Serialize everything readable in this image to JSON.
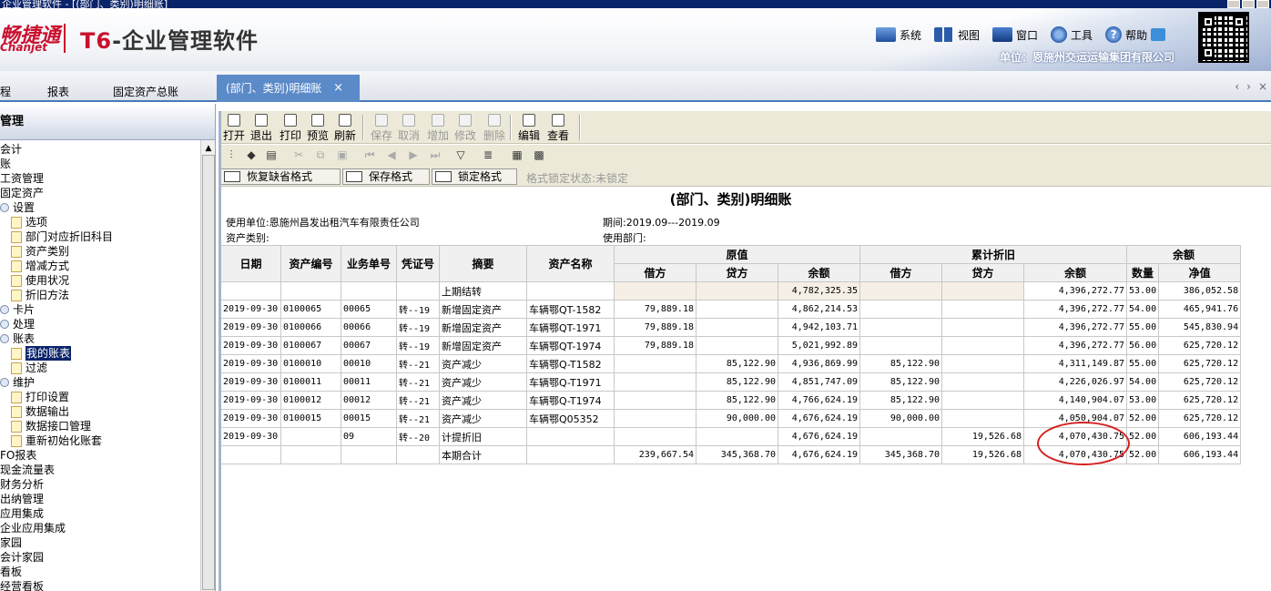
{
  "window": {
    "title": "企业管理软件 - [(部门、类别)明细账]"
  },
  "banner": {
    "logo_cn": "畅捷通",
    "logo_en": "Chanjet",
    "product_t6": "T6",
    "product_rest": "-企业管理软件",
    "menu": [
      {
        "label": "系统",
        "icon": "system-icon"
      },
      {
        "label": "视图",
        "icon": "view-icon"
      },
      {
        "label": "窗口",
        "icon": "window-icon"
      },
      {
        "label": "工具",
        "icon": "tools-icon"
      },
      {
        "label": "帮助",
        "icon": "help-icon"
      }
    ],
    "company": "单位：恩施州交运运输集团有限公司"
  },
  "tabs": {
    "items": [
      {
        "label": "程"
      },
      {
        "label": "报表"
      },
      {
        "label": "固定资产总账"
      }
    ],
    "active": "(部门、类别)明细账",
    "close": "×",
    "arrows": [
      "‹",
      "›",
      "×"
    ]
  },
  "left": {
    "header": "管理",
    "tree": [
      {
        "label": "会计",
        "level": 0,
        "type": "text"
      },
      {
        "label": "账",
        "level": 0,
        "type": "text"
      },
      {
        "label": "工资管理",
        "level": 0,
        "type": "text"
      },
      {
        "label": "固定资产",
        "level": 0,
        "type": "text"
      },
      {
        "label": "设置",
        "level": 1,
        "type": "expander"
      },
      {
        "label": "选项",
        "level": 2,
        "type": "folder"
      },
      {
        "label": "部门对应折旧科目",
        "level": 2,
        "type": "folder"
      },
      {
        "label": "资产类别",
        "level": 2,
        "type": "folder"
      },
      {
        "label": "增减方式",
        "level": 2,
        "type": "folder"
      },
      {
        "label": "使用状况",
        "level": 2,
        "type": "folder"
      },
      {
        "label": "折旧方法",
        "level": 2,
        "type": "folder"
      },
      {
        "label": "卡片",
        "level": 1,
        "type": "expander"
      },
      {
        "label": "处理",
        "level": 1,
        "type": "expander"
      },
      {
        "label": "账表",
        "level": 1,
        "type": "expander"
      },
      {
        "label": "我的账表",
        "level": 2,
        "type": "folder",
        "selected": true
      },
      {
        "label": "过滤",
        "level": 2,
        "type": "folder"
      },
      {
        "label": "维护",
        "level": 1,
        "type": "expander"
      },
      {
        "label": "打印设置",
        "level": 2,
        "type": "folder"
      },
      {
        "label": "数据输出",
        "level": 2,
        "type": "folder"
      },
      {
        "label": "数据接口管理",
        "level": 2,
        "type": "folder"
      },
      {
        "label": "重新初始化账套",
        "level": 2,
        "type": "folder"
      },
      {
        "label": "FO报表",
        "level": 0,
        "type": "text"
      },
      {
        "label": "现金流量表",
        "level": 0,
        "type": "text"
      },
      {
        "label": "财务分析",
        "level": 0,
        "type": "text"
      },
      {
        "label": "出纳管理",
        "level": 0,
        "type": "text"
      },
      {
        "label": "应用集成",
        "level": 0,
        "type": "text"
      },
      {
        "label": "企业应用集成",
        "level": 0,
        "type": "text"
      },
      {
        "label": "家园",
        "level": 0,
        "type": "text"
      },
      {
        "label": "会计家园",
        "level": 0,
        "type": "text"
      },
      {
        "label": "看板",
        "level": 0,
        "type": "text"
      },
      {
        "label": "经营看板",
        "level": 0,
        "type": "text"
      }
    ]
  },
  "toolbar": {
    "buttons": [
      {
        "label": "打开",
        "name": "open-button",
        "disabled": false
      },
      {
        "label": "退出",
        "name": "exit-button",
        "disabled": false
      },
      {
        "label": "打印",
        "name": "print-button",
        "disabled": false
      },
      {
        "label": "预览",
        "name": "preview-button",
        "disabled": false
      },
      {
        "label": "刷新",
        "name": "refresh-button",
        "disabled": false
      },
      {
        "label": "保存",
        "name": "save-button",
        "disabled": true
      },
      {
        "label": "取消",
        "name": "cancel-button",
        "disabled": true
      },
      {
        "label": "增加",
        "name": "add-button",
        "disabled": true
      },
      {
        "label": "修改",
        "name": "modify-button",
        "disabled": true
      },
      {
        "label": "删除",
        "name": "delete-button",
        "disabled": true
      },
      {
        "label": "编辑",
        "name": "edit-button",
        "disabled": false
      },
      {
        "label": "查看",
        "name": "view-button",
        "disabled": false
      }
    ],
    "format": {
      "restore": "恢复缺省格式",
      "save": "保存格式",
      "lock": "锁定格式",
      "status": "格式锁定状态:未锁定"
    }
  },
  "report": {
    "title": "(部门、类别)明细账",
    "unit": "使用单位:恩施州昌发出租汽车有限责任公司",
    "period": "期间:2019.09---2019.09",
    "category": "资产类别:",
    "dept": "使用部门:",
    "headers": {
      "date": "日期",
      "asset_no": "资产编号",
      "biz_no": "业务单号",
      "voucher": "凭证号",
      "summary": "摘要",
      "asset_name": "资产名称",
      "orig_group": "原值",
      "dep_group": "累计折旧",
      "bal_group": "余额",
      "debit": "借方",
      "credit": "贷方",
      "balance": "余额",
      "qty": "数量",
      "net": "净值"
    },
    "rows": [
      [
        "",
        "",
        "",
        "",
        "上期结转",
        "",
        "",
        "",
        "4,782,325.35",
        "",
        "",
        "4,396,272.77",
        "53.00",
        "386,052.58"
      ],
      [
        "2019-09-30",
        "0100065",
        "00065",
        "转--19",
        "新增固定资产",
        "车辆鄂QT-1582",
        "79,889.18",
        "",
        "4,862,214.53",
        "",
        "",
        "4,396,272.77",
        "54.00",
        "465,941.76"
      ],
      [
        "2019-09-30",
        "0100066",
        "00066",
        "转--19",
        "新增固定资产",
        "车辆鄂QT-1971",
        "79,889.18",
        "",
        "4,942,103.71",
        "",
        "",
        "4,396,272.77",
        "55.00",
        "545,830.94"
      ],
      [
        "2019-09-30",
        "0100067",
        "00067",
        "转--19",
        "新增固定资产",
        "车辆鄂QT-1974",
        "79,889.18",
        "",
        "5,021,992.89",
        "",
        "",
        "4,396,272.77",
        "56.00",
        "625,720.12"
      ],
      [
        "2019-09-30",
        "0100010",
        "00010",
        "转--21",
        "资产减少",
        "车辆鄂Q-T1582",
        "",
        "85,122.90",
        "4,936,869.99",
        "85,122.90",
        "",
        "4,311,149.87",
        "55.00",
        "625,720.12"
      ],
      [
        "2019-09-30",
        "0100011",
        "00011",
        "转--21",
        "资产减少",
        "车辆鄂Q-T1971",
        "",
        "85,122.90",
        "4,851,747.09",
        "85,122.90",
        "",
        "4,226,026.97",
        "54.00",
        "625,720.12"
      ],
      [
        "2019-09-30",
        "0100012",
        "00012",
        "转--21",
        "资产减少",
        "车辆鄂Q-T1974",
        "",
        "85,122.90",
        "4,766,624.19",
        "85,122.90",
        "",
        "4,140,904.07",
        "53.00",
        "625,720.12"
      ],
      [
        "2019-09-30",
        "0100015",
        "00015",
        "转--21",
        "资产减少",
        "车辆鄂Q05352",
        "",
        "90,000.00",
        "4,676,624.19",
        "90,000.00",
        "",
        "4,050,904.07",
        "52.00",
        "625,720.12"
      ],
      [
        "2019-09-30",
        "",
        "09",
        "转--20",
        "计提折旧",
        "",
        "",
        "",
        "4,676,624.19",
        "",
        "19,526.68",
        "4,070,430.75",
        "52.00",
        "606,193.44"
      ],
      [
        "",
        "",
        "",
        "",
        "本期合计",
        "",
        "239,667.54",
        "345,368.70",
        "4,676,624.19",
        "345,368.70",
        "19,526.68",
        "4,070,430.75",
        "52.00",
        "606,193.44"
      ]
    ]
  }
}
